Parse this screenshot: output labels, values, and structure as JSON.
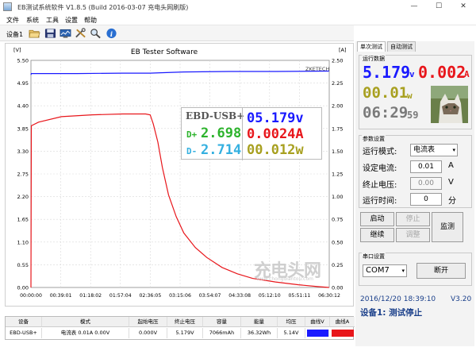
{
  "window": {
    "title": "EB测试系统软件 V1.8.5 (Build 2016-03-07 充电头网刷版)",
    "minimize": "—",
    "maximize": "☐",
    "close": "✕"
  },
  "menu": [
    "文件",
    "系统",
    "工具",
    "设置",
    "帮助"
  ],
  "toolbar": {
    "device_label": "设备1",
    "icons": [
      "folder-open-icon",
      "save-icon",
      "monitor-icon",
      "tools-icon",
      "search-icon",
      "info-icon"
    ]
  },
  "chart": {
    "title": "EB Tester Software",
    "left_unit": "[V]",
    "right_unit": "[A]",
    "brand": "ZKETECH",
    "left_ticks": [
      "5.50",
      "4.95",
      "4.40",
      "3.85",
      "3.30",
      "2.75",
      "2.20",
      "1.65",
      "1.10",
      "0.55",
      "0.00"
    ],
    "right_ticks": [
      "2.50",
      "2.25",
      "2.00",
      "1.75",
      "1.50",
      "1.25",
      "1.00",
      "0.75",
      "0.50",
      "0.25",
      "0.00"
    ],
    "x_ticks": [
      "00:00:00",
      "00:39:01",
      "01:18:02",
      "01:57:04",
      "02:36:05",
      "03:15:06",
      "03:54:07",
      "04:33:08",
      "05:12:10",
      "05:51:11",
      "06:30:12"
    ],
    "watermark": "充电头网",
    "watermark_url": "www.chongdiantou.com"
  },
  "chart_data": {
    "type": "line",
    "title": "EB Tester Software",
    "x": [
      "00:00:00",
      "00:39:01",
      "01:18:02",
      "01:57:04",
      "02:36:05",
      "03:15:06",
      "03:54:07",
      "04:33:08",
      "05:12:10",
      "05:51:11",
      "06:30:12"
    ],
    "xlim": [
      0,
      390.2
    ],
    "ylim_left": [
      0,
      5.5
    ],
    "ylim_right": [
      0,
      2.5
    ],
    "series": [
      {
        "axis": "left",
        "color": "#1a1aff",
        "points": [
          [
            0,
            5.15
          ],
          [
            0.5,
            5.18
          ],
          [
            20,
            5.18
          ],
          [
            60,
            5.18
          ],
          [
            120,
            5.19
          ],
          [
            156,
            5.19
          ],
          [
            170,
            5.2
          ],
          [
            200,
            5.22
          ],
          [
            260,
            5.23
          ],
          [
            320,
            5.23
          ],
          [
            390,
            5.24
          ]
        ]
      },
      {
        "axis": "right",
        "color": "#e8161b",
        "points": [
          [
            0,
            0.0
          ],
          [
            0.5,
            1.78
          ],
          [
            10,
            1.82
          ],
          [
            40,
            1.88
          ],
          [
            80,
            1.9
          ],
          [
            120,
            1.91
          ],
          [
            150,
            1.91
          ],
          [
            156,
            1.9
          ],
          [
            160,
            1.8
          ],
          [
            166,
            1.6
          ],
          [
            172,
            1.32
          ],
          [
            180,
            1.02
          ],
          [
            190,
            0.78
          ],
          [
            200,
            0.6
          ],
          [
            215,
            0.44
          ],
          [
            230,
            0.33
          ],
          [
            250,
            0.22
          ],
          [
            270,
            0.15
          ],
          [
            290,
            0.1
          ],
          [
            320,
            0.06
          ],
          [
            350,
            0.03
          ],
          [
            375,
            0.01
          ],
          [
            390,
            0.0
          ]
        ]
      }
    ]
  },
  "overlay": {
    "device": "EBD-USB+",
    "voltage": "05.179v",
    "dplus_label": "D+",
    "dplus": "2.698",
    "current": "0.0024A",
    "dminus_label": "D-",
    "dminus": "2.714",
    "power": "00.012w"
  },
  "table": {
    "headers": [
      "设备",
      "模式",
      "起始电压",
      "终止电压",
      "容量",
      "能量",
      "均压",
      "曲线V",
      "曲线A"
    ],
    "row": [
      "EBD-USB+",
      "电流表  0.01A  0.00V",
      "0.000V",
      "5.179V",
      "7066mAh",
      "36.32Wh",
      "5.14V",
      "",
      ""
    ],
    "curve_v_color": "#1a1aff",
    "curve_a_color": "#e8161b"
  },
  "panel": {
    "tabs": [
      "单次测试",
      "自动测试"
    ],
    "run_title": "运行数据",
    "lcd_voltage": "5.179",
    "lcd_voltage_unit": "v",
    "lcd_current": "0.002",
    "lcd_current_unit": "A",
    "lcd_power": "00.01",
    "lcd_power_unit": "w",
    "lcd_time": "06:29",
    "lcd_seconds": "59",
    "params_title": "参数设置",
    "mode_label": "运行模式:",
    "mode_value": "电流表",
    "set_current_label": "设定电流:",
    "set_current_value": "0.01",
    "set_current_unit": "A",
    "stop_voltage_label": "终止电压:",
    "stop_voltage_value": "0.00",
    "stop_voltage_unit": "V",
    "run_time_label": "运行时间:",
    "run_time_value": "0",
    "run_time_unit": "分",
    "btn_start": "启动",
    "btn_stop": "停止",
    "btn_continue": "继续",
    "btn_adjust": "调整",
    "btn_monitor": "监测",
    "serial_title": "串口设置",
    "port_value": "COM7",
    "btn_disconnect": "断开",
    "status_time": "2016/12/20 18:39:10",
    "status_version": "V3.20",
    "status_text": "设备1: 测试停止"
  },
  "colors": {
    "voltage": "#1a1aff",
    "current": "#e8161b",
    "dplus": "#2db32d",
    "dminus": "#35b0e0",
    "power": "#a8a020",
    "time": "#7a7a7a"
  }
}
